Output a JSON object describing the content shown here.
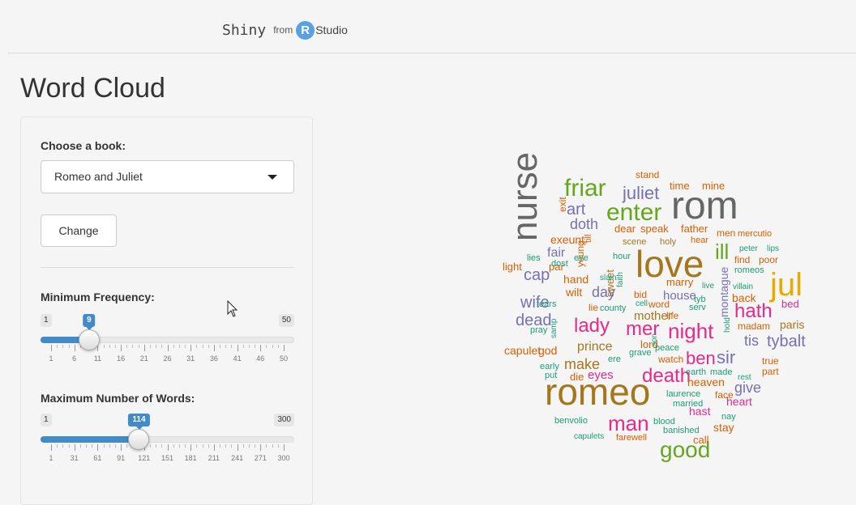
{
  "header": {
    "shiny": "Shiny",
    "from": "from",
    "r_letter": "R",
    "studio": "Studio"
  },
  "page": {
    "title": "Word Cloud"
  },
  "sidebar": {
    "book_label": "Choose a book:",
    "book_selected": "Romeo and Juliet",
    "change_button": "Change",
    "freq": {
      "label": "Minimum Frequency:",
      "min": 1,
      "max": 50,
      "value": 9,
      "min_text": "1",
      "max_text": "50",
      "value_text": "9",
      "ticks": [
        "1",
        "6",
        "11",
        "16",
        "21",
        "26",
        "31",
        "36",
        "41",
        "46",
        "50"
      ]
    },
    "words": {
      "label": "Maximum Number of Words:",
      "min": 1,
      "max": 300,
      "value": 114,
      "min_text": "1",
      "max_text": "300",
      "value_text": "114",
      "ticks": [
        "1",
        "31",
        "61",
        "91",
        "121",
        "151",
        "181",
        "211",
        "241",
        "271",
        "300"
      ]
    }
  },
  "colors": {
    "gray": "#666666",
    "orange": "#d95f02",
    "purple": "#7570b3",
    "pink": "#e7298a",
    "green": "#66a61e",
    "gold": "#e6ab02",
    "brown": "#a6761d",
    "teal": "#1b9e77",
    "accent": "#428bca"
  },
  "wordcloud": [
    {
      "text": "romeo",
      "color": "brown"
    },
    {
      "text": "rom",
      "color": "gray"
    },
    {
      "text": "love",
      "color": "brown"
    },
    {
      "text": "nurse",
      "color": "gray"
    },
    {
      "text": "jul",
      "color": "gold"
    },
    {
      "text": "good",
      "color": "green"
    },
    {
      "text": "death",
      "color": "pink"
    },
    {
      "text": "man",
      "color": "pink"
    },
    {
      "text": "night",
      "color": "pink"
    },
    {
      "text": "enter",
      "color": "green"
    },
    {
      "text": "friar",
      "color": "green"
    },
    {
      "text": "hath",
      "color": "pink"
    },
    {
      "text": "lady",
      "color": "pink"
    },
    {
      "text": "mer",
      "color": "pink"
    },
    {
      "text": "ben",
      "color": "pink"
    },
    {
      "text": "juliet",
      "color": "purple"
    },
    {
      "text": "tybalt",
      "color": "purple"
    },
    {
      "text": "art",
      "color": "purple"
    },
    {
      "text": "doth",
      "color": "purple"
    },
    {
      "text": "wife",
      "color": "purple"
    },
    {
      "text": "dead",
      "color": "purple"
    },
    {
      "text": "cap",
      "color": "purple"
    },
    {
      "text": "day",
      "color": "purple"
    },
    {
      "text": "sir",
      "color": "purple"
    },
    {
      "text": "ill",
      "color": "green"
    },
    {
      "text": "give",
      "color": "purple"
    },
    {
      "text": "tis",
      "color": "purple"
    },
    {
      "text": "paris",
      "color": "brown"
    },
    {
      "text": "capulet",
      "color": "orange"
    },
    {
      "text": "prince",
      "color": "brown"
    },
    {
      "text": "make",
      "color": "brown"
    },
    {
      "text": "eyes",
      "color": "pink"
    },
    {
      "text": "mother",
      "color": "brown"
    },
    {
      "text": "house",
      "color": "purple"
    },
    {
      "text": "fair",
      "color": "purple"
    },
    {
      "text": "exeunt",
      "color": "orange"
    },
    {
      "text": "montague",
      "color": "purple"
    },
    {
      "text": "sweet",
      "color": "brown"
    },
    {
      "text": "back",
      "color": "orange"
    },
    {
      "text": "heaven",
      "color": "orange"
    },
    {
      "text": "lord",
      "color": "orange"
    },
    {
      "text": "stay",
      "color": "orange"
    },
    {
      "text": "heart",
      "color": "pink"
    },
    {
      "text": "hast",
      "color": "pink"
    },
    {
      "text": "bed",
      "color": "pink"
    },
    {
      "text": "true",
      "color": "orange"
    },
    {
      "text": "part",
      "color": "orange"
    },
    {
      "text": "wilt",
      "color": "orange"
    },
    {
      "text": "hand",
      "color": "orange"
    },
    {
      "text": "speak",
      "color": "orange"
    },
    {
      "text": "dear",
      "color": "orange"
    },
    {
      "text": "stand",
      "color": "orange"
    },
    {
      "text": "time",
      "color": "orange"
    },
    {
      "text": "mine",
      "color": "orange"
    },
    {
      "text": "father",
      "color": "orange"
    },
    {
      "text": "men",
      "color": "orange"
    },
    {
      "text": "mercutio",
      "color": "orange"
    },
    {
      "text": "marry",
      "color": "orange"
    },
    {
      "text": "madam",
      "color": "orange"
    },
    {
      "text": "call",
      "color": "orange"
    },
    {
      "text": "light",
      "color": "orange"
    },
    {
      "text": "par",
      "color": "orange"
    },
    {
      "text": "god",
      "color": "orange"
    },
    {
      "text": "die",
      "color": "orange"
    },
    {
      "text": "hear",
      "color": "orange"
    },
    {
      "text": "find",
      "color": "orange"
    },
    {
      "text": "poor",
      "color": "orange"
    },
    {
      "text": "life",
      "color": "orange"
    },
    {
      "text": "bid",
      "color": "orange"
    },
    {
      "text": "face",
      "color": "orange"
    },
    {
      "text": "exit",
      "color": "orange"
    },
    {
      "text": "young",
      "color": "orange"
    },
    {
      "text": "watch",
      "color": "orange"
    },
    {
      "text": "word",
      "color": "orange"
    },
    {
      "text": "farewell",
      "color": "orange"
    },
    {
      "text": "scene",
      "color": "brown"
    },
    {
      "text": "holy",
      "color": "brown"
    },
    {
      "text": "lie",
      "color": "orange"
    },
    {
      "text": "till",
      "color": "orange"
    },
    {
      "text": "peter",
      "color": "teal"
    },
    {
      "text": "lips",
      "color": "teal"
    },
    {
      "text": "romeos",
      "color": "teal"
    },
    {
      "text": "villain",
      "color": "teal"
    },
    {
      "text": "live",
      "color": "teal"
    },
    {
      "text": "hour",
      "color": "teal"
    },
    {
      "text": "eye",
      "color": "teal"
    },
    {
      "text": "lies",
      "color": "teal"
    },
    {
      "text": "dost",
      "color": "teal"
    },
    {
      "text": "slain",
      "color": "teal"
    },
    {
      "text": "faith",
      "color": "teal"
    },
    {
      "text": "tears",
      "color": "teal"
    },
    {
      "text": "county",
      "color": "teal"
    },
    {
      "text": "cell",
      "color": "teal"
    },
    {
      "text": "tyb",
      "color": "teal"
    },
    {
      "text": "serv",
      "color": "teal"
    },
    {
      "text": "pray",
      "color": "teal"
    },
    {
      "text": "samp",
      "color": "teal"
    },
    {
      "text": "son",
      "color": "teal"
    },
    {
      "text": "grave",
      "color": "teal"
    },
    {
      "text": "peace",
      "color": "teal"
    },
    {
      "text": "hold",
      "color": "teal"
    },
    {
      "text": "early",
      "color": "teal"
    },
    {
      "text": "put",
      "color": "teal"
    },
    {
      "text": "ere",
      "color": "teal"
    },
    {
      "text": "earth",
      "color": "teal"
    },
    {
      "text": "made",
      "color": "teal"
    },
    {
      "text": "rest",
      "color": "teal"
    },
    {
      "text": "laurence",
      "color": "teal"
    },
    {
      "text": "married",
      "color": "teal"
    },
    {
      "text": "nay",
      "color": "teal"
    },
    {
      "text": "benvolio",
      "color": "teal"
    },
    {
      "text": "blood",
      "color": "teal"
    },
    {
      "text": "banished",
      "color": "teal"
    },
    {
      "text": "capulets",
      "color": "teal"
    }
  ]
}
